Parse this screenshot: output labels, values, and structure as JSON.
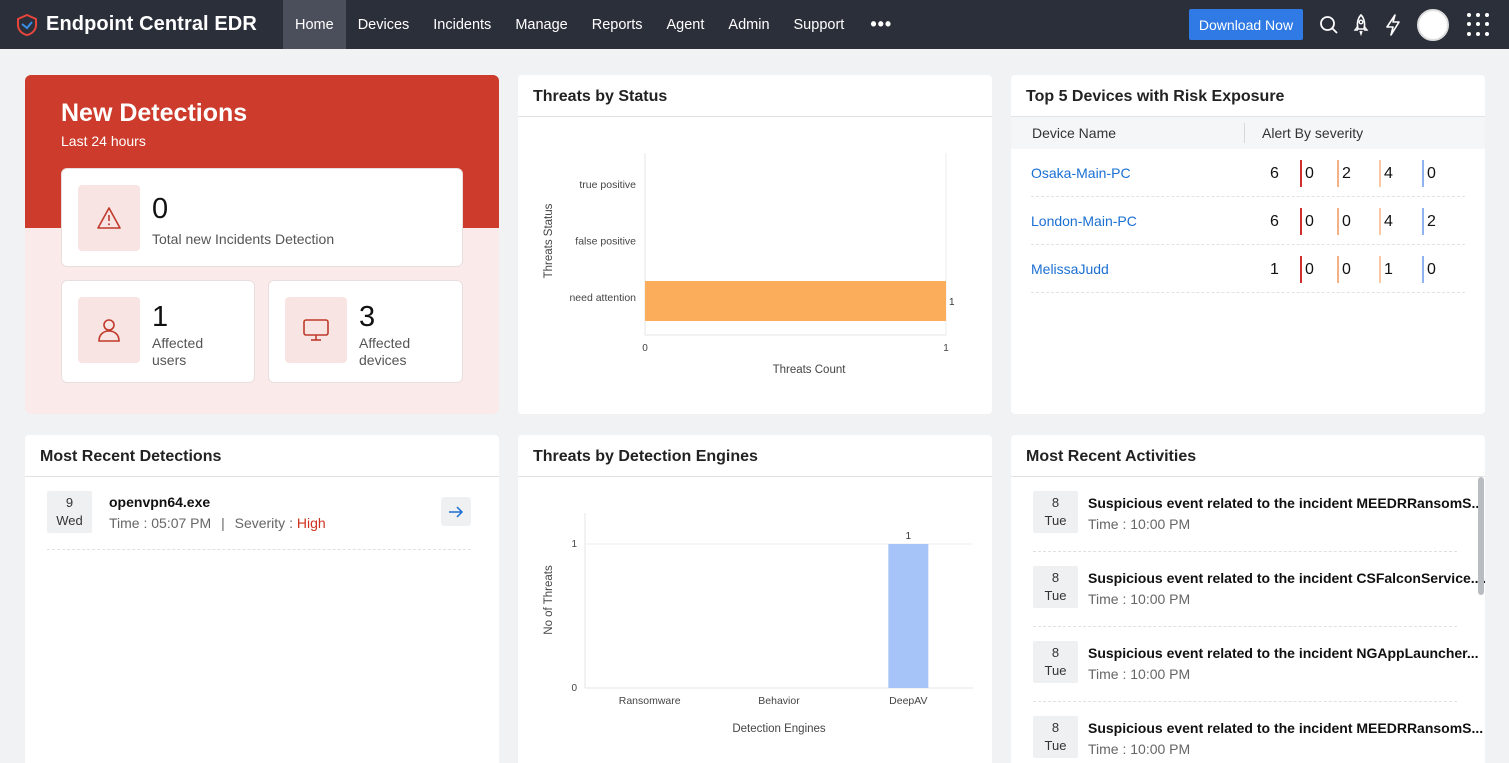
{
  "app": {
    "title": "Endpoint Central EDR"
  },
  "nav": [
    {
      "label": "Home",
      "active": true
    },
    {
      "label": "Devices"
    },
    {
      "label": "Incidents"
    },
    {
      "label": "Manage"
    },
    {
      "label": "Reports"
    },
    {
      "label": "Agent"
    },
    {
      "label": "Admin"
    },
    {
      "label": "Support"
    }
  ],
  "topbar": {
    "more": "•••",
    "download_label": "Download Now"
  },
  "new_detections": {
    "title": "New Detections",
    "subtitle": "Last 24 hours",
    "incidents": {
      "value": "0",
      "label": "Total new Incidents Detection"
    },
    "users": {
      "value": "1",
      "label_1": "Affected",
      "label_2": "users"
    },
    "devices": {
      "value": "3",
      "label_1": "Affected",
      "label_2": "devices"
    }
  },
  "threats_by_status": {
    "title": "Threats by Status",
    "chart_data": {
      "type": "bar",
      "orientation": "horizontal",
      "categories": [
        "true positive",
        "false positive",
        "need attention"
      ],
      "values": [
        0,
        0,
        1
      ],
      "xlabel": "Threats Count",
      "ylabel": "Threats Status",
      "xlim": [
        0,
        1
      ],
      "ticks": [
        "0",
        "1"
      ],
      "data_labels": [
        "",
        "",
        "1"
      ],
      "color": "#fbad5c"
    }
  },
  "top5": {
    "title": "Top 5 Devices with Risk Exposure",
    "col_device": "Device Name",
    "col_alert": "Alert By severity",
    "severity_colors": [
      "#d32f2f",
      "#f4b183",
      "#f9c9a6",
      "#8fb3ee"
    ],
    "rows": [
      {
        "name": "Osaka-Main-PC",
        "values": [
          "6",
          "0",
          "2",
          "4",
          "0"
        ]
      },
      {
        "name": "London-Main-PC",
        "values": [
          "6",
          "0",
          "0",
          "4",
          "2"
        ]
      },
      {
        "name": "MelissaJudd",
        "values": [
          "1",
          "0",
          "0",
          "1",
          "0"
        ]
      }
    ]
  },
  "recent_detections": {
    "title": "Most Recent Detections",
    "items": [
      {
        "day": "9",
        "weekday": "Wed",
        "name": "openvpn64.exe",
        "time_label": "Time : 05:07 PM",
        "sep": "|",
        "severity_label": "Severity :",
        "severity": "High"
      }
    ]
  },
  "detection_engines": {
    "title": "Threats by Detection Engines",
    "chart_data": {
      "type": "bar",
      "categories": [
        "Ransomware",
        "Behavior",
        "DeepAV"
      ],
      "values": [
        0,
        0,
        1
      ],
      "xlabel": "Detection Engines",
      "ylabel": "No of Threats",
      "ylim": [
        0,
        1
      ],
      "ticks": [
        "0",
        "1"
      ],
      "data_labels": [
        "",
        "",
        "1"
      ],
      "color": "#a7c4f8"
    }
  },
  "recent_activities": {
    "title": "Most Recent Activities",
    "items": [
      {
        "day": "8",
        "weekday": "Tue",
        "title": "Suspicious event related to the incident MEEDRRansomS...",
        "time": "Time : 10:00 PM"
      },
      {
        "day": "8",
        "weekday": "Tue",
        "title": "Suspicious event related to the incident CSFalconService....",
        "time": "Time : 10:00 PM"
      },
      {
        "day": "8",
        "weekday": "Tue",
        "title": "Suspicious event related to the incident NGAppLauncher...",
        "time": "Time : 10:00 PM"
      },
      {
        "day": "8",
        "weekday": "Tue",
        "title": "Suspicious event related to the incident MEEDRRansomS...",
        "time": "Time : 10:00 PM"
      }
    ]
  }
}
